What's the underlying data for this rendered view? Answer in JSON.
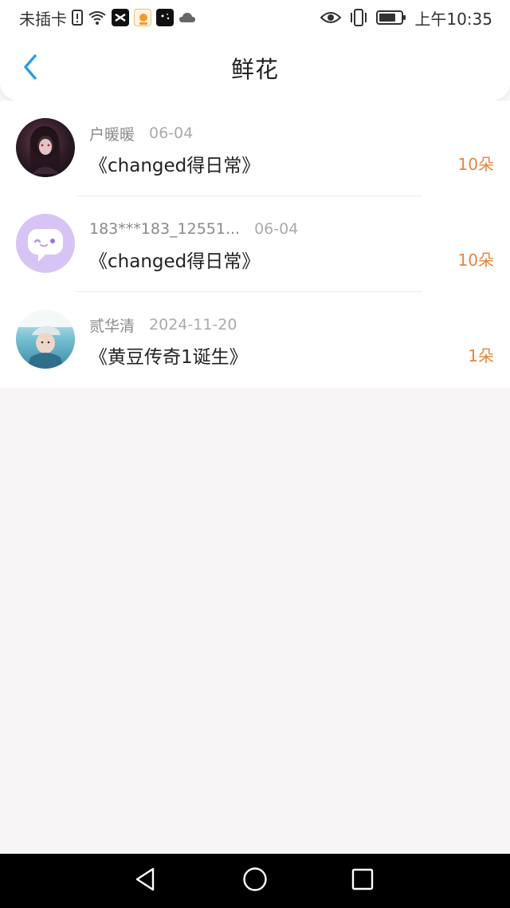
{
  "status_bar": {
    "carrier": "未插卡",
    "time": "上午10:35",
    "icons": [
      "sim-alert-icon",
      "wifi-icon",
      "capcut-app-icon",
      "orange-app-icon",
      "dark-app-icon",
      "cloud-icon",
      "eye-icon",
      "vibrate-icon",
      "battery-icon"
    ]
  },
  "header": {
    "title": "鲜花",
    "back_icon": "chevron-left-icon",
    "accent": "#2a9de8"
  },
  "list": {
    "items": [
      {
        "name": "户暖暖",
        "date": "06-04",
        "book": "《changed得日常》",
        "count": "10朵"
      },
      {
        "name": "183***183_12551...",
        "date": "06-04",
        "book": "《changed得日常》",
        "count": "10朵"
      },
      {
        "name": "贰华清",
        "date": "2024-11-20",
        "book": "《黄豆传奇1诞生》",
        "count": "1朵"
      }
    ],
    "count_color": "#e8843c"
  },
  "nav_bar": {
    "icons": [
      "back-triangle-icon",
      "home-circle-icon",
      "recents-square-icon"
    ]
  }
}
